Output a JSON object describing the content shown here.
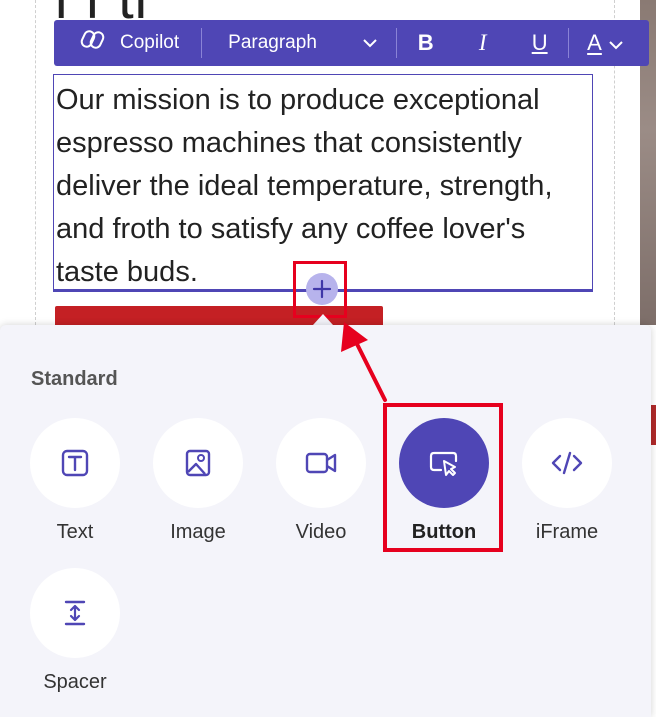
{
  "page": {
    "heading_partial": "l          f  ti"
  },
  "toolbar": {
    "copilot_label": "Copilot",
    "paragraph_label": "Paragraph",
    "bold_label": "B",
    "italic_label": "I",
    "underline_label": "U",
    "font_color_label": "A",
    "icons": {
      "copilot": "copilot-icon",
      "paragraph_dropdown": "chevron-down-icon",
      "font_color_dropdown": "chevron-down-icon"
    }
  },
  "editor": {
    "text": "Our mission is to produce exceptional espresso machines that consistently deliver the ideal temperature, strength, and froth to satisfy any coffee lover's taste buds."
  },
  "add_button": {
    "label": "+"
  },
  "panel": {
    "section_title": "Standard",
    "items": [
      {
        "label": "Text",
        "icon": "text-icon"
      },
      {
        "label": "Image",
        "icon": "image-icon"
      },
      {
        "label": "Video",
        "icon": "video-icon"
      },
      {
        "label": "Button",
        "icon": "button-cursor-icon",
        "selected": true
      },
      {
        "label": "iFrame",
        "icon": "code-icon"
      },
      {
        "label": "Spacer",
        "icon": "spacer-icon"
      }
    ]
  },
  "colors": {
    "accent": "#4f46b5",
    "highlight": "#e6001e",
    "panel_bg": "#f4f4fa",
    "cta_red": "#c42024"
  }
}
